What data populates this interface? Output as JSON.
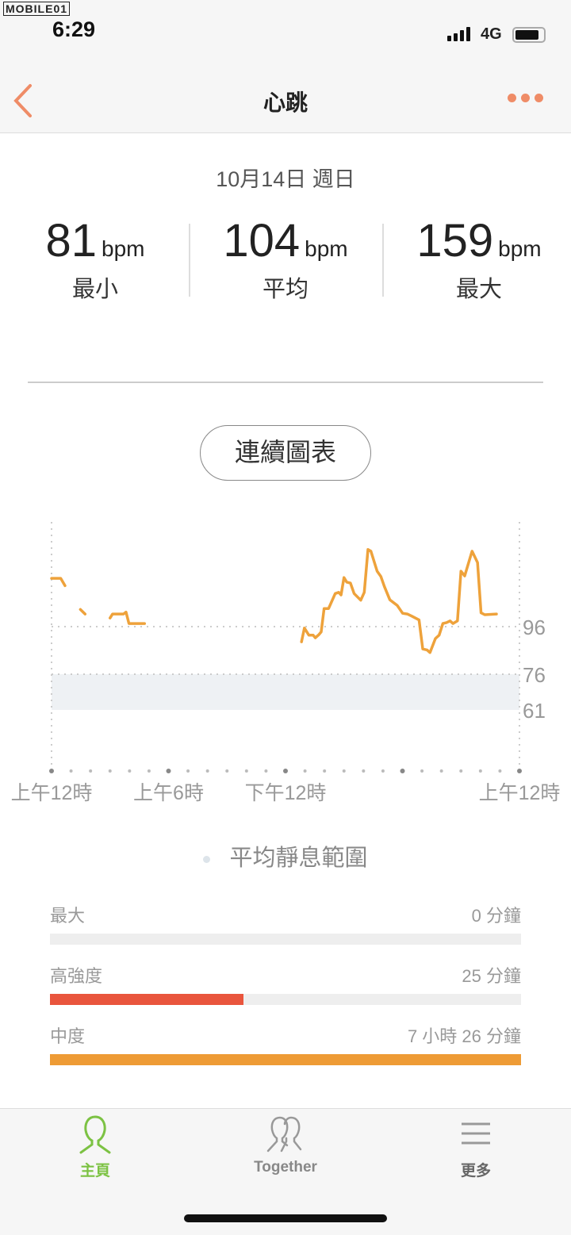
{
  "status_bar": {
    "watermark": "MOBILE01",
    "time": "6:29",
    "network": "4G",
    "battery_level": 0.85
  },
  "nav": {
    "title": "心跳",
    "back_icon": "chevron-left-icon",
    "more_icon": "more-dots-icon",
    "accent": "#ef8c67"
  },
  "date": "10月14日 週日",
  "stats": [
    {
      "value": "81",
      "unit": "bpm",
      "label": "最小"
    },
    {
      "value": "104",
      "unit": "bpm",
      "label": "平均"
    },
    {
      "value": "159",
      "unit": "bpm",
      "label": "最大"
    }
  ],
  "chart_button": "連續圖表",
  "chart_data": {
    "type": "line",
    "xlim": [
      0,
      24
    ],
    "ylim": [
      40,
      140
    ],
    "line_color": "#eea23b",
    "y_ticks": [
      {
        "value": 96,
        "label": "96"
      },
      {
        "value": 76,
        "label": "76"
      },
      {
        "value": 61,
        "label": "61"
      }
    ],
    "x_ticks": [
      {
        "value": 0,
        "label": "上午12時"
      },
      {
        "value": 6,
        "label": "上午6時"
      },
      {
        "value": 12,
        "label": "下午12時"
      },
      {
        "value": 24,
        "label": "上午12時"
      }
    ],
    "resting_range": [
      61,
      76
    ],
    "segments": [
      [
        [
          0,
          116.3
        ],
        [
          0.47,
          116.3
        ],
        [
          0.69,
          113.2
        ]
      ],
      [
        [
          1.48,
          103.2
        ],
        [
          1.72,
          101.3
        ]
      ],
      [
        [
          3.0,
          99.6
        ],
        [
          3.13,
          101.3
        ],
        [
          3.69,
          101.3
        ],
        [
          3.82,
          102.1
        ],
        [
          3.97,
          97.3
        ],
        [
          4.77,
          97.3
        ]
      ],
      [
        [
          12.82,
          89.6
        ],
        [
          12.97,
          95.4
        ],
        [
          13.2,
          92.4
        ],
        [
          13.42,
          92.4
        ],
        [
          13.53,
          91.3
        ],
        [
          13.72,
          92.7
        ],
        [
          13.83,
          93.8
        ],
        [
          13.98,
          103.6
        ],
        [
          14.21,
          103.6
        ],
        [
          14.55,
          109.9
        ],
        [
          14.73,
          110.4
        ],
        [
          14.85,
          109.3
        ],
        [
          15.0,
          116.6
        ],
        [
          15.14,
          114.7
        ],
        [
          15.33,
          114.3
        ],
        [
          15.52,
          109.9
        ],
        [
          15.86,
          107.1
        ],
        [
          16.04,
          110.4
        ],
        [
          16.23,
          128.4
        ],
        [
          16.38,
          127.7
        ],
        [
          16.7,
          119.3
        ],
        [
          16.89,
          117.1
        ],
        [
          17.07,
          112.9
        ],
        [
          17.35,
          107.3
        ],
        [
          17.73,
          104.9
        ],
        [
          18.01,
          101.6
        ],
        [
          18.25,
          101.3
        ],
        [
          18.48,
          100.4
        ],
        [
          18.85,
          98.8
        ],
        [
          19.04,
          86.6
        ],
        [
          19.26,
          86.2
        ],
        [
          19.41,
          85.1
        ],
        [
          19.69,
          91.0
        ],
        [
          19.88,
          92.4
        ],
        [
          20.07,
          97.3
        ],
        [
          20.26,
          97.7
        ],
        [
          20.44,
          98.4
        ],
        [
          20.59,
          97.3
        ],
        [
          20.82,
          98.4
        ],
        [
          21.0,
          119.3
        ],
        [
          21.19,
          117.3
        ],
        [
          21.57,
          127.7
        ],
        [
          21.85,
          122.9
        ],
        [
          22.03,
          101.8
        ],
        [
          22.22,
          101.0
        ],
        [
          22.82,
          101.3
        ]
      ]
    ]
  },
  "legend": "平均靜息範圍",
  "zones": [
    {
      "label": "最大",
      "value": "0 分鐘",
      "fraction": 0,
      "color": "#e9553d"
    },
    {
      "label": "高強度",
      "value": "25 分鐘",
      "fraction": 0.41,
      "color": "#e9553d"
    },
    {
      "label": "中度",
      "value": "7 小時 26 分鐘",
      "fraction": 1.0,
      "color": "#ee9b35"
    }
  ],
  "tabs": [
    {
      "label": "主頁",
      "icon": "person-icon",
      "active": true,
      "color": "#7cc243"
    },
    {
      "label": "Together",
      "icon": "people-icon",
      "active": false,
      "color": "#888888"
    },
    {
      "label": "更多",
      "icon": "menu-icon",
      "active": false,
      "color": "#666666"
    }
  ]
}
